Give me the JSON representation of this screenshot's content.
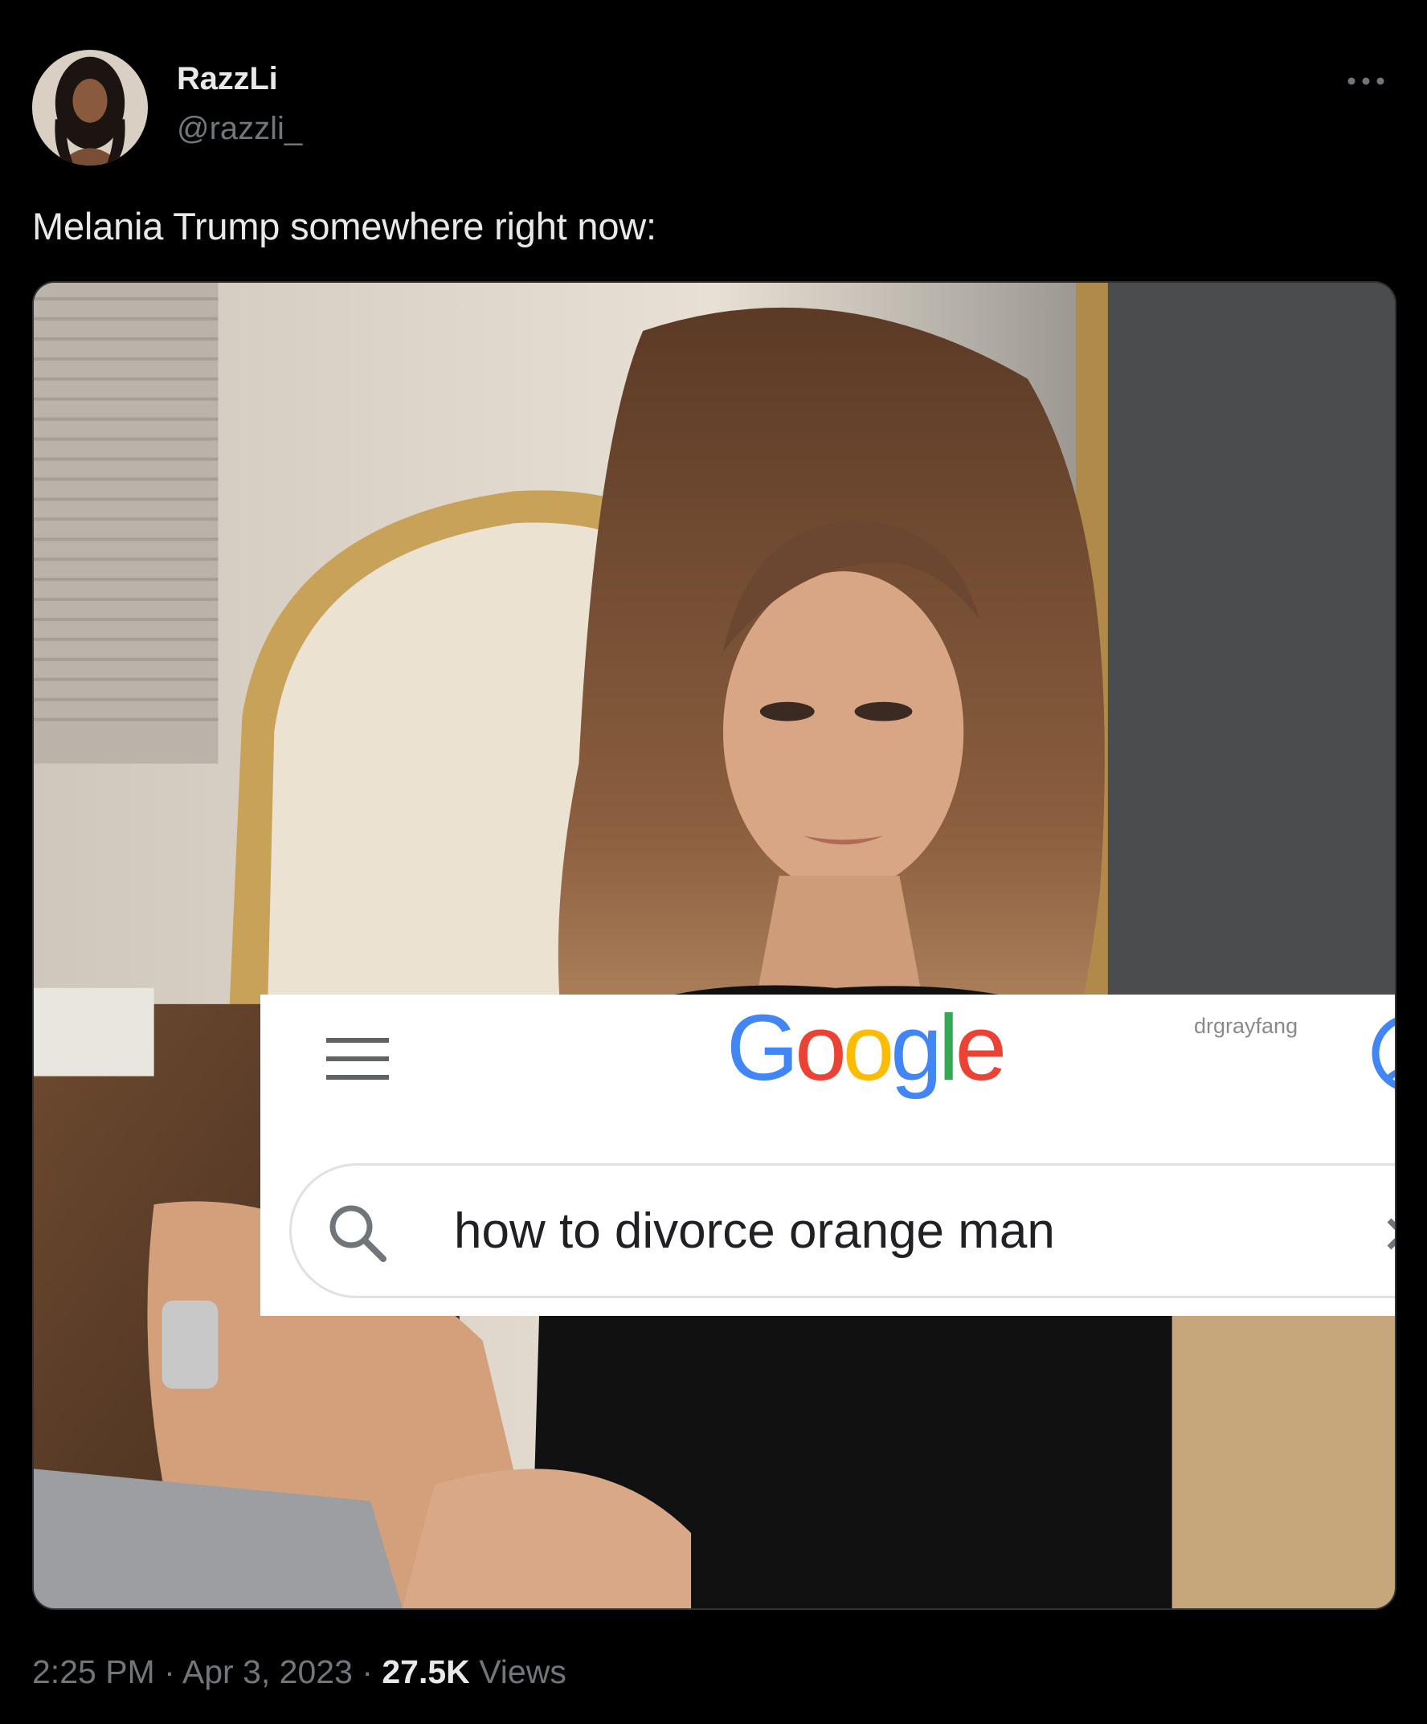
{
  "tweet": {
    "author": {
      "display_name": "RazzLi",
      "handle": "@razzli_",
      "avatar_icon": "profile-photo"
    },
    "more_icon": "ellipsis-icon",
    "text": "Melania Trump somewhere right now:",
    "media": {
      "overlay": {
        "menu_icon": "hamburger-menu-icon",
        "logo": {
          "letters": [
            "G",
            "o",
            "o",
            "g",
            "l",
            "e"
          ],
          "colors": [
            "#4285F4",
            "#EA4335",
            "#FBBC05",
            "#4285F4",
            "#34A853",
            "#EA4335"
          ]
        },
        "watermark": "drgrayfang",
        "account_icon": "account-circle-icon",
        "search_icon": "magnifier-icon",
        "search_query": "how to divorce orange man",
        "clear_icon": "close-icon"
      }
    },
    "meta": {
      "time": "2:25 PM",
      "separator": "·",
      "date": "Apr 3, 2023",
      "views_count": "27.5K",
      "views_label": "Views"
    }
  },
  "colors": {
    "background": "#000000",
    "primary_text": "#e7e9ea",
    "secondary_text": "#71767b"
  }
}
